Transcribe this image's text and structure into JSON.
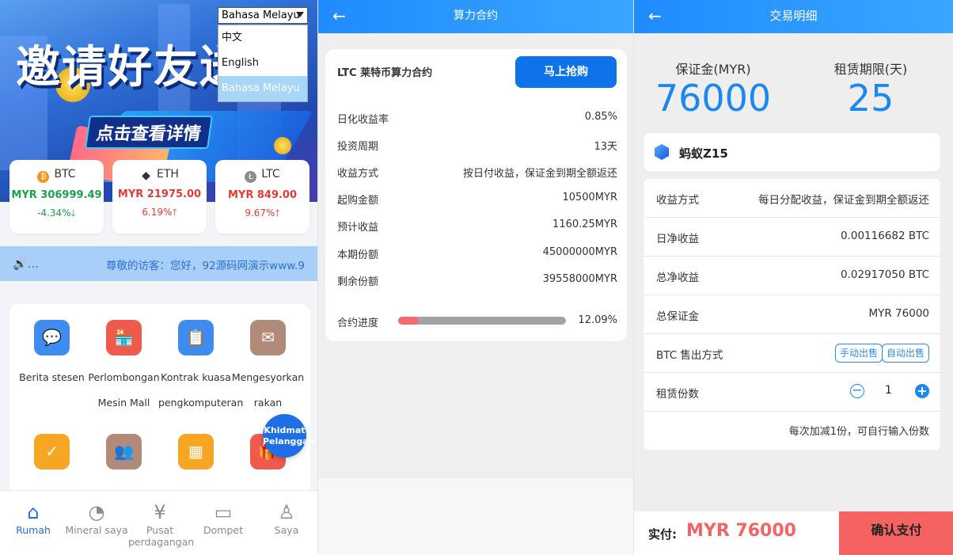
{
  "home": {
    "banner": {
      "headline": "邀请好友送",
      "cta": "点击查看详情"
    },
    "language": {
      "selected": "Bahasa Melayu",
      "options": [
        "中文",
        "English",
        "Bahasa Melayu"
      ]
    },
    "prices": [
      {
        "symbol": "BTC",
        "price": "MYR 306999.49",
        "change": "-4.34%",
        "direction": "down",
        "color": "#16a34a"
      },
      {
        "symbol": "ETH",
        "price": "MYR 21975.00",
        "change": "6.19%",
        "direction": "up",
        "color": "#e53935"
      },
      {
        "symbol": "LTC",
        "price": "MYR 849.00",
        "change": "9.67%",
        "direction": "up",
        "color": "#e53935"
      }
    ],
    "marquee": {
      "speaker": "🔊...",
      "text": "尊敬的访客：您好，92源码网演示www.9"
    },
    "grid": [
      {
        "label1": "Berita stesen",
        "label2": "",
        "icon": "chat-icon",
        "color": "#3e8cf0"
      },
      {
        "label1": "Perlombongan",
        "label2": "Mesin Mall",
        "icon": "shop-icon",
        "color": "#ef5a4c"
      },
      {
        "label1": "Kontrak kuasa",
        "label2": "pengkomputeran",
        "icon": "contract-icon",
        "color": "#3e8cf0"
      },
      {
        "label1": "Mengesyorkan",
        "label2": "rakan",
        "icon": "mail-icon",
        "color": "#b28a7a"
      },
      {
        "label1": "",
        "label2": "",
        "icon": "calendar-icon",
        "color": "#f6a623"
      },
      {
        "label1": "",
        "label2": "",
        "icon": "users-icon",
        "color": "#b28a7a"
      },
      {
        "label1": "",
        "label2": "",
        "icon": "calculator-icon",
        "color": "#f6a623"
      },
      {
        "label1": "",
        "label2": "",
        "icon": "gift-icon",
        "color": "#ef5a4c"
      }
    ],
    "customer_service": {
      "line1": "Khidmat",
      "line2": "Pelanggan"
    },
    "tabs": [
      {
        "label": "Rumah",
        "icon": "home-icon",
        "active": true
      },
      {
        "label": "Mineral saya",
        "icon": "pie-icon",
        "active": false
      },
      {
        "label": "Pusat perdagangan",
        "icon": "yen-icon",
        "active": false
      },
      {
        "label": "Dompet",
        "icon": "wallet-icon",
        "active": false
      },
      {
        "label": "Saya",
        "icon": "user-icon",
        "active": false
      }
    ]
  },
  "contract": {
    "title": "算力合约",
    "card_title": "LTC 莱特币算力合约",
    "buy_button": "马上抢购",
    "rows": [
      {
        "k": "日化收益率",
        "v": "0.85%"
      },
      {
        "k": "投资周期",
        "v": "13天"
      },
      {
        "k": "收益方式",
        "v": "按日付收益，保证金到期全额返还"
      },
      {
        "k": "起购金额",
        "v": "10500MYR"
      },
      {
        "k": "预计收益",
        "v": "1160.25MYR"
      },
      {
        "k": "本期份额",
        "v": "45000000MYR"
      },
      {
        "k": "剩余份额",
        "v": "39558000MYR"
      }
    ],
    "progress": {
      "label": "合约进度",
      "value": "12.09%",
      "fraction": 0.1209
    }
  },
  "trade": {
    "title": "交易明细",
    "deposit": {
      "label": "保证金(MYR)",
      "value": "76000"
    },
    "term": {
      "label": "租赁期限(天)",
      "value": "25"
    },
    "product": "蚂蚁Z15",
    "rows": [
      {
        "k": "收益方式",
        "v": "每日分配收益，保证金到期全额返还"
      },
      {
        "k": "日净收益",
        "v": "0.00116682 BTC"
      },
      {
        "k": "总净收益",
        "v": "0.02917050 BTC"
      },
      {
        "k": "总保证金",
        "v": "MYR 76000"
      }
    ],
    "sell": {
      "k": "BTC 售出方式",
      "manual": "手动出售",
      "auto": "自动出售"
    },
    "qty": {
      "k": "租赁份数",
      "value": "1",
      "minus": "−",
      "plus": "+"
    },
    "note": "每次加减1份，可自行输入份数",
    "footer": {
      "label": "实付:",
      "amount": "MYR 76000",
      "pay": "确认支付"
    }
  }
}
